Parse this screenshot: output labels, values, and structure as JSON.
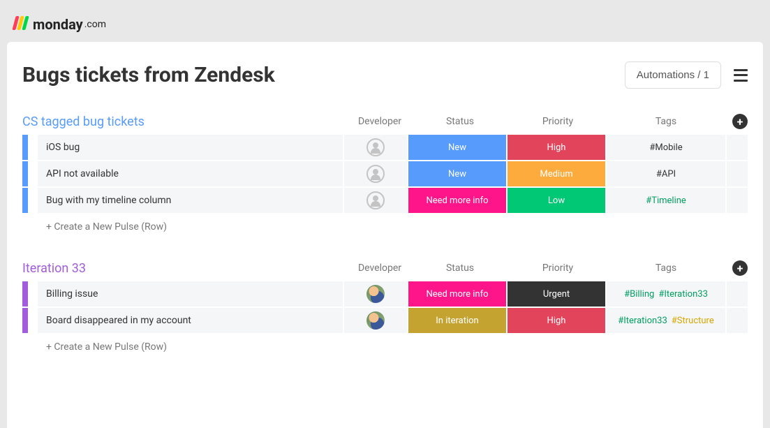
{
  "brand": {
    "name": "monday",
    "suffix": ".com"
  },
  "page": {
    "title": "Bugs tickets from Zendesk",
    "automations_label": "Automations / 1"
  },
  "columns": {
    "developer": "Developer",
    "status": "Status",
    "priority": "Priority",
    "tags": "Tags"
  },
  "groups": [
    {
      "id": "cs",
      "title": "CS tagged bug tickets",
      "color": "blue",
      "new_row_label": "+ Create a New Pulse (Row)",
      "rows": [
        {
          "name": "iOS bug",
          "developer": "empty",
          "status": {
            "label": "New",
            "color": "c-blue"
          },
          "priority": {
            "label": "High",
            "color": "c-red"
          },
          "tags": [
            {
              "text": "#Mobile",
              "cls": "tag-dark"
            }
          ]
        },
        {
          "name": "API not available",
          "developer": "empty",
          "status": {
            "label": "New",
            "color": "c-blue"
          },
          "priority": {
            "label": "Medium",
            "color": "c-orange"
          },
          "tags": [
            {
              "text": "#API",
              "cls": "tag-dark"
            }
          ]
        },
        {
          "name": "Bug with my timeline column",
          "developer": "empty",
          "status": {
            "label": "Need more info",
            "color": "c-pink"
          },
          "priority": {
            "label": "Low",
            "color": "c-green"
          },
          "tags": [
            {
              "text": "#Timeline",
              "cls": "tag-green"
            }
          ]
        }
      ]
    },
    {
      "id": "it33",
      "title": "Iteration 33",
      "color": "purple",
      "new_row_label": "+ Create a New Pulse (Row)",
      "rows": [
        {
          "name": "Billing issue",
          "developer": "filled",
          "status": {
            "label": "Need more info",
            "color": "c-pink"
          },
          "priority": {
            "label": "Urgent",
            "color": "c-black"
          },
          "tags": [
            {
              "text": "#Billing",
              "cls": "tag-green"
            },
            {
              "text": "#Iteration33",
              "cls": "tag-green"
            }
          ]
        },
        {
          "name": "Board disappeared in my account",
          "developer": "filled",
          "status": {
            "label": "In iteration",
            "color": "c-olive"
          },
          "priority": {
            "label": "High",
            "color": "c-red"
          },
          "tags": [
            {
              "text": "#Iteration33",
              "cls": "tag-green"
            },
            {
              "text": "#Structure",
              "cls": "tag-amber"
            }
          ]
        }
      ]
    }
  ]
}
